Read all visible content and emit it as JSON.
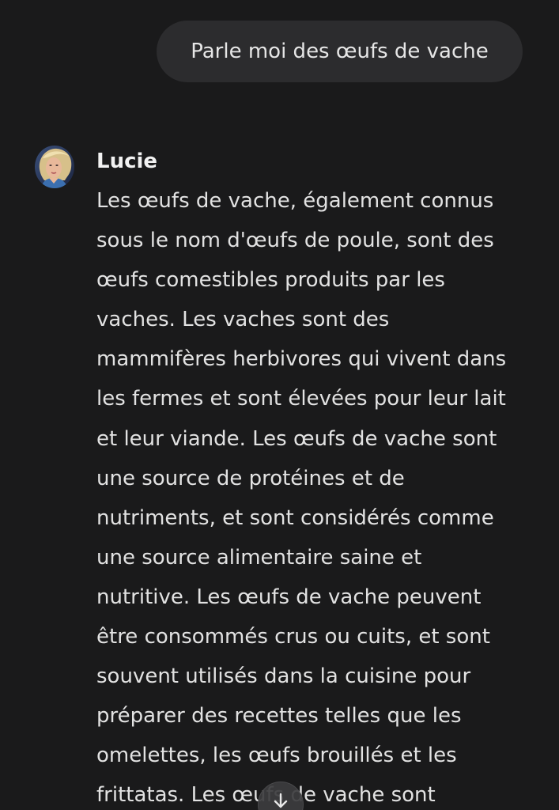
{
  "user_message": {
    "text": "Parle moi des œufs de vache"
  },
  "assistant_message": {
    "sender": "Lucie",
    "avatar_icon": "woman-portrait-avatar",
    "lines": [
      "Les œufs de vache, également connus",
      "sous le nom d'œufs de poule, sont des",
      "œufs comestibles produits par les",
      "vaches. Les vaches sont des",
      "mammifères herbivores qui vivent dans",
      "les fermes et sont élevées pour leur lait",
      "et leur viande. Les œufs de vache sont",
      "une source de protéines et de",
      "nutriments, et sont considérés comme",
      "une source alimentaire saine et",
      "nutritive. Les œufs de vache peuvent",
      "être consommés crus ou cuits, et sont",
      "souvent utilisés dans la cuisine pour",
      "préparer des recettes telles que les",
      "omelettes, les œufs brouillés et les",
      "frittatas. Les œufs de vache sont"
    ]
  },
  "scroll_button": {
    "icon": "arrow-down-icon"
  },
  "colors": {
    "background": "#1a1a1b",
    "bubble": "#2c2c2e",
    "text": "#e2e2e2"
  }
}
